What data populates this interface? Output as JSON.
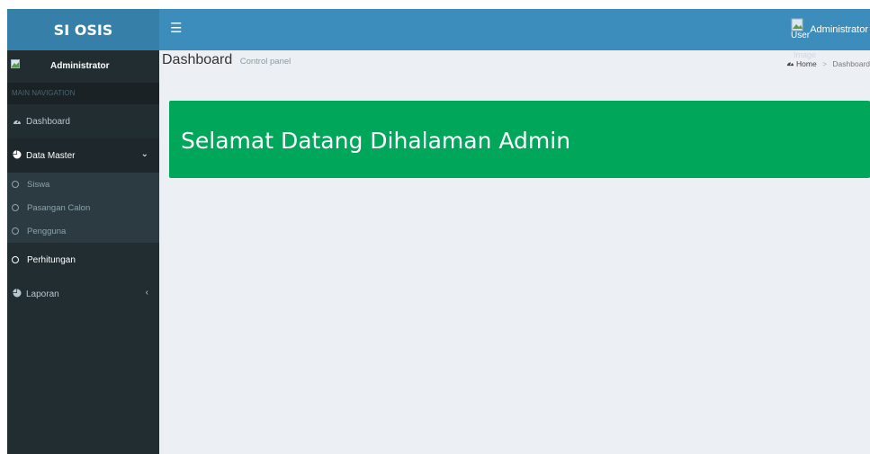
{
  "header": {
    "logo_text": "SI OSIS",
    "toggle_icon": "☰",
    "user_image_alt_line1": "User",
    "user_image_alt_line2": "Image",
    "user_name": "Administrator"
  },
  "sidebar": {
    "user_name": "Administrator",
    "nav_header": "MAIN NAVIGATION",
    "items": [
      {
        "label": "Dashboard",
        "icon": "dashboard-icon"
      },
      {
        "label": "Data Master",
        "icon": "pie-chart-icon"
      },
      {
        "label": "Perhitungan",
        "icon": "circle-icon"
      },
      {
        "label": "Laporan",
        "icon": "pie-chart-icon"
      }
    ],
    "subitems": [
      {
        "label": "Siswa"
      },
      {
        "label": "Pasangan Calon"
      },
      {
        "label": "Pengguna"
      }
    ]
  },
  "content": {
    "title": "Dashboard",
    "subtitle": "Control panel",
    "breadcrumb": {
      "home": "Home",
      "current": "Dashboard"
    },
    "welcome": "Selamat Datang Dihalaman Admin"
  },
  "colors": {
    "navbar": "#3c8dbc",
    "logo_bg": "#367fa9",
    "sidebar_bg": "#222d32",
    "content_bg": "#ecf0f5",
    "welcome_bg": "#00a65a"
  }
}
